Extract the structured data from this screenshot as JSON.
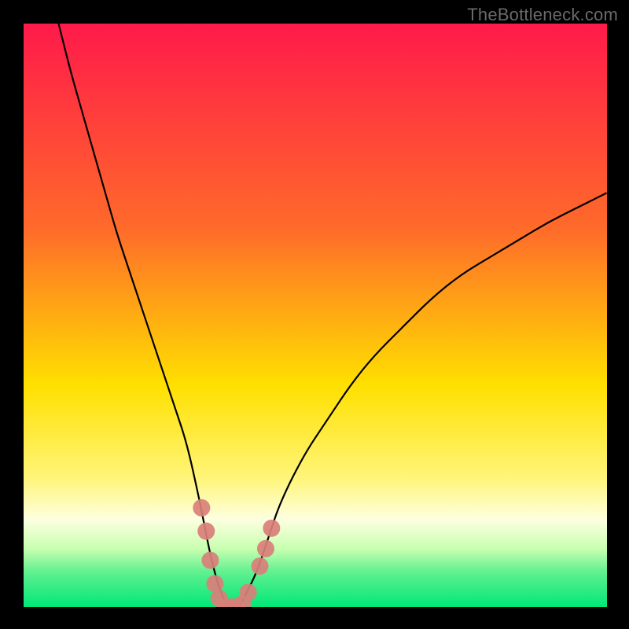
{
  "attribution": "TheBottleneck.com",
  "chart_data": {
    "type": "line",
    "title": "",
    "xlabel": "",
    "ylabel": "",
    "xlim": [
      0,
      100
    ],
    "ylim": [
      0,
      100
    ],
    "series": [
      {
        "name": "bottleneck-curve",
        "x": [
          6,
          8,
          10,
          12,
          14,
          16,
          18,
          20,
          22,
          24,
          26,
          28,
          30,
          31,
          32,
          33,
          34,
          35,
          36,
          37,
          38,
          40,
          42,
          44,
          48,
          52,
          56,
          60,
          65,
          70,
          75,
          80,
          85,
          90,
          95,
          100
        ],
        "y": [
          100,
          92,
          85,
          78,
          71,
          64,
          58,
          52,
          46,
          40,
          34,
          28,
          19,
          14,
          9,
          5,
          2,
          0,
          0,
          0,
          2,
          6,
          12,
          18,
          26,
          32,
          38,
          43,
          48,
          53,
          57,
          60,
          63,
          66,
          68.5,
          71
        ]
      }
    ],
    "markers": {
      "name": "highlight-dots",
      "points": [
        {
          "x": 30.5,
          "y": 17
        },
        {
          "x": 31.3,
          "y": 13
        },
        {
          "x": 32.0,
          "y": 8
        },
        {
          "x": 32.8,
          "y": 4
        },
        {
          "x": 33.5,
          "y": 1.5
        },
        {
          "x": 34.5,
          "y": 0
        },
        {
          "x": 35.5,
          "y": 0
        },
        {
          "x": 36.5,
          "y": 0
        },
        {
          "x": 37.5,
          "y": 0.5
        },
        {
          "x": 38.5,
          "y": 2.5
        },
        {
          "x": 40.5,
          "y": 7
        },
        {
          "x": 41.5,
          "y": 10
        },
        {
          "x": 42.5,
          "y": 13.5
        }
      ]
    },
    "background": {
      "type": "vertical-gradient",
      "stops": [
        {
          "pos": 0,
          "color": "#ff1a4a"
        },
        {
          "pos": 35,
          "color": "#ff6a2a"
        },
        {
          "pos": 62,
          "color": "#ffe000"
        },
        {
          "pos": 78,
          "color": "#fff57a"
        },
        {
          "pos": 85,
          "color": "#fdffe0"
        },
        {
          "pos": 90,
          "color": "#c8ffb0"
        },
        {
          "pos": 94,
          "color": "#60f090"
        },
        {
          "pos": 100,
          "color": "#00e878"
        }
      ]
    }
  }
}
